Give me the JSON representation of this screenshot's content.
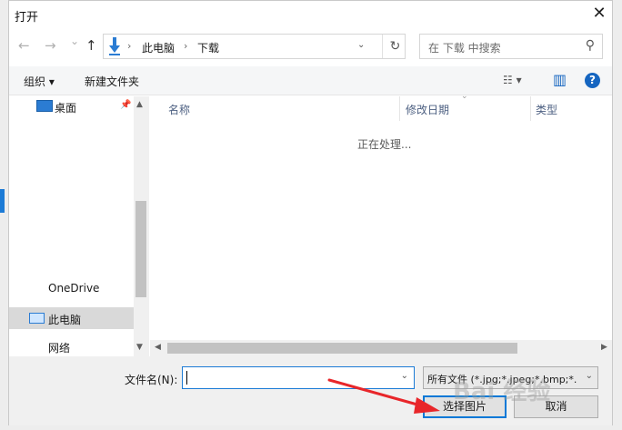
{
  "window": {
    "title": "打开",
    "close_glyph": "✕"
  },
  "nav": {
    "back_glyph": "←",
    "forward_glyph": "→",
    "recent_glyph": "⌄",
    "up_glyph": "↑"
  },
  "address": {
    "crumbs": [
      "此电脑",
      "下载"
    ],
    "separator": "›",
    "dropdown_glyph": "⌄",
    "refresh_glyph": "↻"
  },
  "search": {
    "placeholder": "在 下载 中搜索",
    "icon_glyph": "⚲"
  },
  "toolbar": {
    "organize_label": "组织 ▾",
    "new_folder_label": "新建文件夹",
    "view_label": "☷ ▾",
    "pane_glyph": "▥",
    "help_glyph": "?"
  },
  "navpane": {
    "items": [
      {
        "label": "桌面",
        "pinned": true
      },
      {
        "label": "OneDrive"
      },
      {
        "label": "此电脑",
        "selected": true
      },
      {
        "label": "网络"
      }
    ],
    "pin_glyph": "📌"
  },
  "filelist": {
    "columns": [
      "名称",
      "修改日期",
      "类型"
    ],
    "status_text": "正在处理...",
    "sort_glyph": "⌄"
  },
  "scroll": {
    "up": "▲",
    "down": "▼",
    "left": "◀",
    "right": "▶"
  },
  "footer": {
    "filename_label": "文件名(N):",
    "filename_value": "",
    "filter_text": "所有文件 (*.jpg;*.jpeg;*.bmp;*.",
    "dropdown_glyph": "⌄",
    "open_button": "选择图片",
    "cancel_button": "取消"
  },
  "overlay": {
    "watermark": "Bai 经验",
    "arrow_color": "#e8262a"
  },
  "colors": {
    "accent": "#0078d7",
    "selection": "#d9d9d9"
  }
}
